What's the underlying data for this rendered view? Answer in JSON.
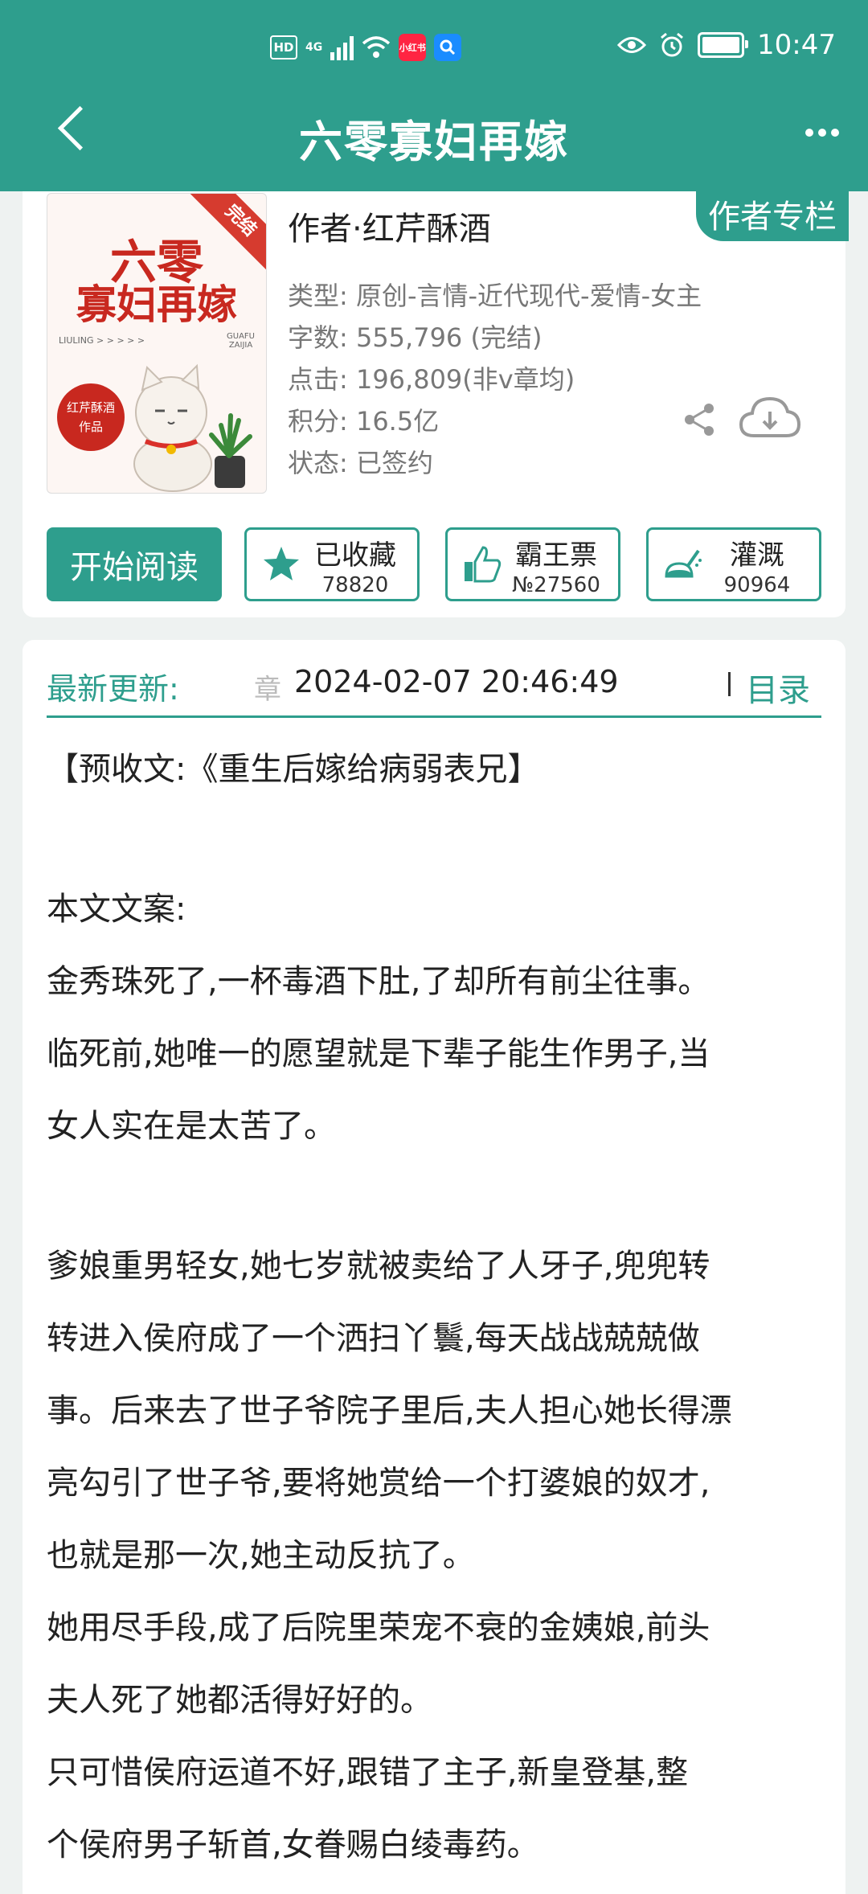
{
  "status_bar": {
    "hd": "HD",
    "network": "4G",
    "app_badge": "小红书",
    "time": "10:47"
  },
  "header": {
    "title": "六零寡妇再嫁",
    "back_icon": "chevron-left-icon",
    "more_icon": "more-dots-icon"
  },
  "book": {
    "cover": {
      "badge": "完结",
      "title_line1": "六零",
      "title_line2": "寡妇再嫁",
      "pinyin_left": "LIULING > > > > >",
      "pinyin_right_1": "GUAFU",
      "pinyin_right_2": "ZAIJIA",
      "seal_1": "红芹酥酒",
      "seal_2": "作品"
    },
    "author": "作者·红芹酥酒",
    "author_column_button": "作者专栏",
    "meta": {
      "type": "类型: 原创-言情-近代现代-爱情-女主",
      "words": "字数: 555,796 (完结)",
      "clicks": "点击: 196,809(非v章均)",
      "points": "积分: 16.5亿",
      "status": "状态: 已签约"
    },
    "actions": {
      "start_reading": "开始阅读",
      "favorite_label": "已收藏",
      "favorite_count": "78820",
      "overlord_label": "霸王票",
      "overlord_count": "№27560",
      "water_label": "灌溉",
      "water_count": "90964"
    }
  },
  "update": {
    "label": "最新更新:",
    "chapter_hint": "章",
    "time": "2024-02-07 20:46:49",
    "toc": "目录"
  },
  "content": {
    "l1": "【预收文:《重生后嫁给病弱表兄】",
    "l2": "本文文案:",
    "l3": "金秀珠死了,一杯毒酒下肚,了却所有前尘往事。",
    "l4": "临死前,她唯一的愿望就是下辈子能生作男子,当",
    "l5": "女人实在是太苦了。",
    "l6": "爹娘重男轻女,她七岁就被卖给了人牙子,兜兜转",
    "l7": "转进入侯府成了一个洒扫丫鬟,每天战战兢兢做",
    "l8": "事。后来去了世子爷院子里后,夫人担心她长得漂",
    "l9": "亮勾引了世子爷,要将她赏给一个打婆娘的奴才,",
    "l10": "也就是那一次,她主动反抗了。",
    "l11": "她用尽手段,成了后院里荣宠不衰的金姨娘,前头",
    "l12": "夫人死了她都活得好好的。",
    "l13": "只可惜侯府运道不好,跟错了主子,新皇登基,整",
    "l14": "个侯府男子斩首,女眷赐白绫毒药。"
  },
  "colors": {
    "accent": "#2e9e8d",
    "cover_red": "#c8281f"
  }
}
